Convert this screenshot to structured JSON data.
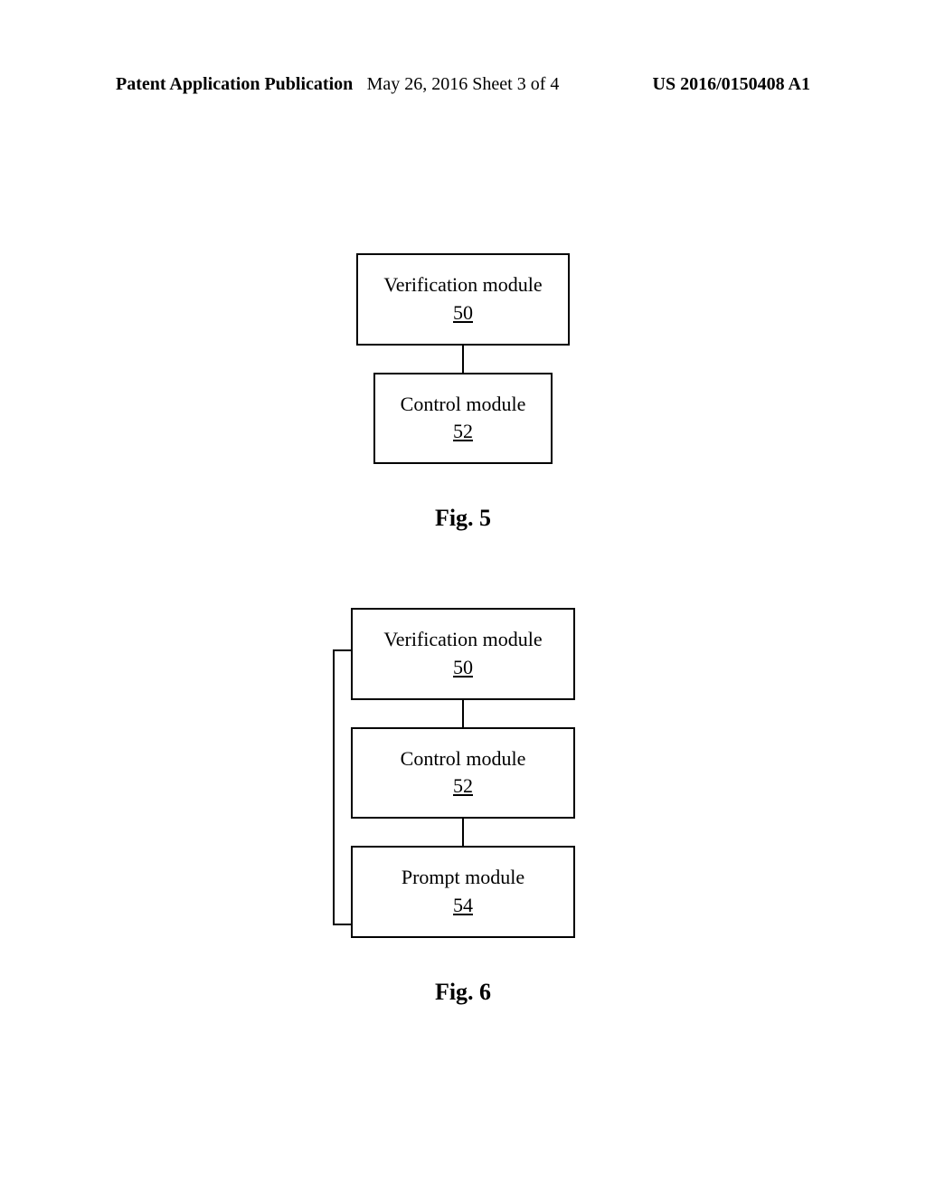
{
  "header": {
    "left": "Patent Application Publication",
    "center": "May 26, 2016 Sheet 3 of 4",
    "right": "US 2016/0150408 A1"
  },
  "fig5": {
    "block1_label": "Verification module",
    "block1_ref": "50",
    "block2_label": "Control module",
    "block2_ref": "52",
    "caption": "Fig. 5"
  },
  "fig6": {
    "block1_label": "Verification module",
    "block1_ref": "50",
    "block2_label": "Control module",
    "block2_ref": "52",
    "block3_label": "Prompt module",
    "block3_ref": "54",
    "caption": "Fig. 6"
  }
}
